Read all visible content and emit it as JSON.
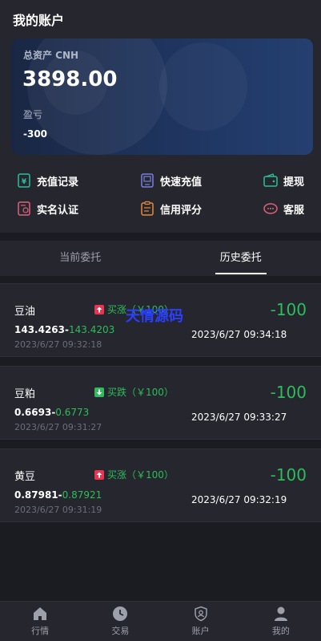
{
  "page": {
    "title": "我的账户"
  },
  "account": {
    "total_assets_label": "总资产 CNH",
    "total_assets_value": "3898.00",
    "pnl_label": "盈亏",
    "pnl_value": "-300"
  },
  "quick_actions": [
    {
      "label": "充值记录",
      "icon": "recharge-record-icon",
      "color": "#2dbd9a"
    },
    {
      "label": "快速充值",
      "icon": "quick-recharge-icon",
      "color": "#7b7fe0"
    },
    {
      "label": "提现",
      "icon": "withdraw-wallet-icon",
      "color": "#2dbd9a"
    },
    {
      "label": "实名认证",
      "icon": "id-verify-icon",
      "color": "#e0607a"
    },
    {
      "label": "信用评分",
      "icon": "credit-score-icon",
      "color": "#e58a3a"
    },
    {
      "label": "客服",
      "icon": "customer-service-icon",
      "color": "#e0607a"
    }
  ],
  "tabs": [
    {
      "label": "当前委托",
      "active": false
    },
    {
      "label": "历史委托",
      "active": true
    }
  ],
  "watermark": "天情源码",
  "orders": [
    {
      "name": "豆油",
      "direction": "up",
      "badge": "买涨（￥100）",
      "open_price": "143.4263",
      "close_price": "143.4203",
      "open_time": "2023/6/27 09:32:18",
      "profit": "-100",
      "close_time": "2023/6/27 09:34:18"
    },
    {
      "name": "豆粕",
      "direction": "down",
      "badge": "买跌（￥100）",
      "open_price": "0.6693",
      "close_price": "0.6773",
      "open_time": "2023/6/27 09:31:27",
      "profit": "-100",
      "close_time": "2023/6/27 09:33:27"
    },
    {
      "name": "黄豆",
      "direction": "up",
      "badge": "买涨（￥100）",
      "open_price": "0.87981",
      "close_price": "0.87921",
      "open_time": "2023/6/27 09:31:19",
      "profit": "-100",
      "close_time": "2023/6/27 09:32:19"
    }
  ],
  "bottom_nav": [
    {
      "label": "行情",
      "icon": "home-icon"
    },
    {
      "label": "交易",
      "icon": "clock-icon"
    },
    {
      "label": "账户",
      "icon": "shield-user-icon"
    },
    {
      "label": "我的",
      "icon": "person-icon"
    }
  ],
  "colors": {
    "up": "#e8344e",
    "down": "#2dbd5a",
    "profit_text": "#2dbd5a",
    "background": "#1b1c22",
    "panel": "#25262e"
  }
}
